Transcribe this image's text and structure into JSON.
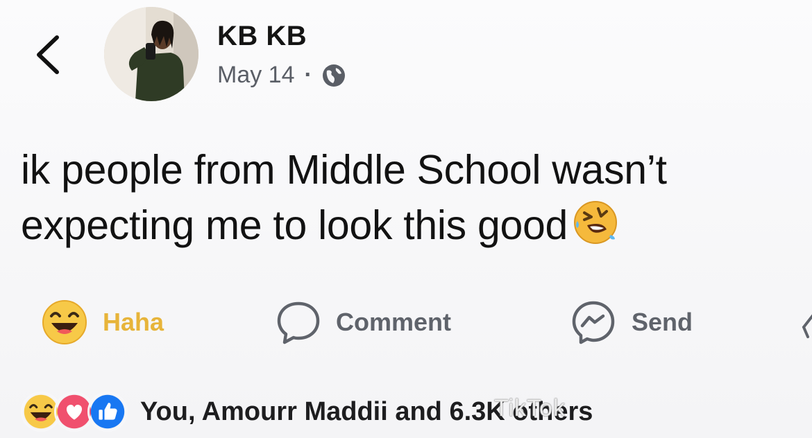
{
  "post": {
    "author_name": "KB KB",
    "date": "May 14",
    "separator": "·",
    "privacy_icon": "globe-icon",
    "text": "ik people from Middle School wasn’t expecting me to look this good",
    "text_emoji": "rolling-on-floor-laughing-emoji"
  },
  "actions": {
    "haha_label": "Haha",
    "comment_label": "Comment",
    "send_label": "Send"
  },
  "reactions": {
    "icons": [
      "haha-icon",
      "love-icon",
      "like-icon"
    ],
    "summary": "You, Amourr Maddii and 6.3K others"
  },
  "watermark": {
    "text": "TikTok"
  },
  "colors": {
    "haha_yellow": "#f7c948",
    "love_red": "#f0506e",
    "like_blue": "#1877f2",
    "muted_text": "#5f636b"
  }
}
